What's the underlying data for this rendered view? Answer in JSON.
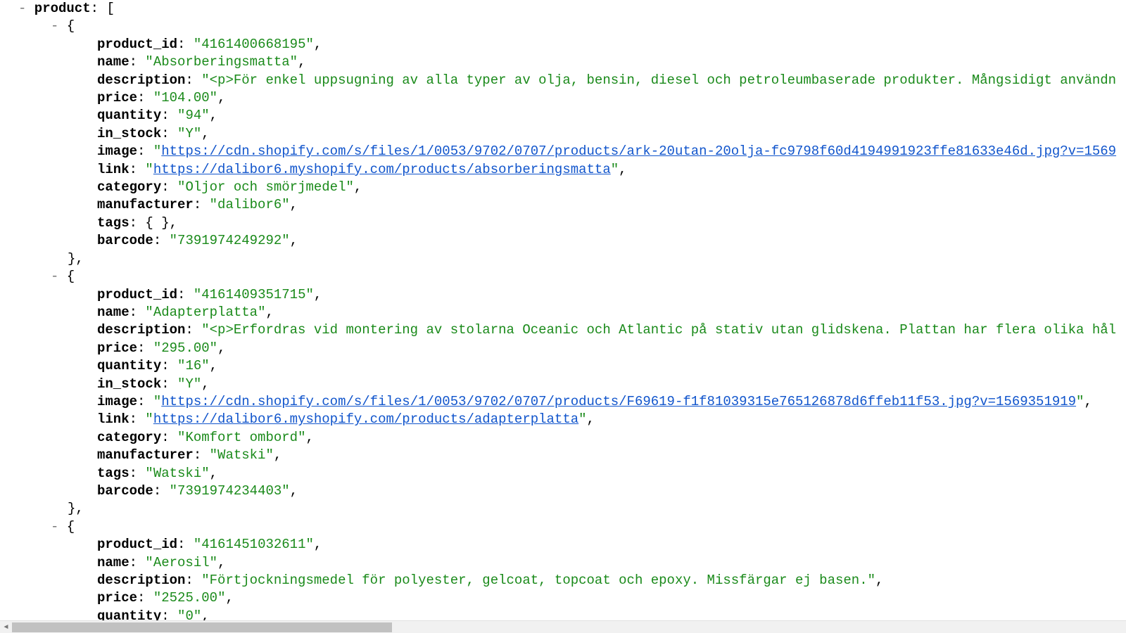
{
  "root_key": "product",
  "products": [
    {
      "product_id": "4161400668195",
      "name": "Absorberingsmatta",
      "description": "<p>För enkel uppsugning av alla typer av olja, bensin, diesel och petroleumbaserade produkter. Mångsidigt användn",
      "price": "104.00",
      "quantity": "94",
      "in_stock": "Y",
      "image": "https://cdn.shopify.com/s/files/1/0053/9702/0707/products/ark-20utan-20olja-fc9798f60d4194991923ffe81633e46d.jpg?v=1569",
      "link": "https://dalibor6.myshopify.com/products/absorberingsmatta",
      "category": "Oljor och smörjmedel",
      "manufacturer": "dalibor6",
      "tags": "{ }",
      "barcode": "7391974249292"
    },
    {
      "product_id": "4161409351715",
      "name": "Adapterplatta",
      "description": "<p>Erfordras vid montering av stolarna Oceanic och Atlantic på stativ utan glidskena. Plattan har flera olika hål",
      "price": "295.00",
      "quantity": "16",
      "in_stock": "Y",
      "image": "https://cdn.shopify.com/s/files/1/0053/9702/0707/products/F69619-f1f81039315e765126878d6ffeb11f53.jpg?v=1569351919",
      "link": "https://dalibor6.myshopify.com/products/adapterplatta",
      "category": "Komfort ombord",
      "manufacturer": "Watski",
      "tags_value": "Watski",
      "barcode": "7391974234403"
    },
    {
      "product_id": "4161451032611",
      "name": "Aerosil",
      "description": "Förtjockningsmedel för polyester, gelcoat, topcoat och epoxy. Missfärgar ej basen.",
      "price": "2525.00",
      "quantity": "0"
    }
  ],
  "labels": {
    "product_id": "product_id",
    "name": "name",
    "description": "description",
    "price": "price",
    "quantity": "quantity",
    "in_stock": "in_stock",
    "image": "image",
    "link": "link",
    "category": "category",
    "manufacturer": "manufacturer",
    "tags": "tags",
    "barcode": "barcode"
  },
  "toggle": "-",
  "punct": {
    "open_array": "[",
    "open_obj": "{",
    "close_obj": "},",
    "colon": ":",
    "quote": "\"",
    "comma": ","
  }
}
